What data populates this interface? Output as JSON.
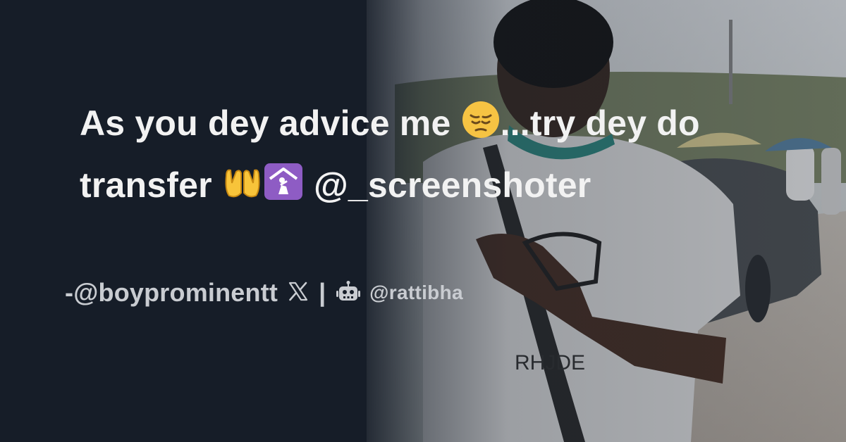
{
  "tweet": {
    "line1_start": "As you dey advice me ",
    "line1_emoji": "pensive-face-emoji",
    "line1_end": "...try dey do",
    "line2_start": "transfer ",
    "line2_emoji1": "palms-up-together-emoji",
    "line2_emoji2": "place-of-worship-emoji",
    "line2_end": " @_screenshoter"
  },
  "attribution": {
    "prefix": "- ",
    "author": "@boyprominentt",
    "platform_icon": "x-logo-icon",
    "separator": "|",
    "brand_icon": "robot-icon",
    "brand": "@rattibha"
  },
  "colors": {
    "background": "#161d28",
    "text": "#f2f2f2",
    "muted_text": "#c9ccd1"
  }
}
